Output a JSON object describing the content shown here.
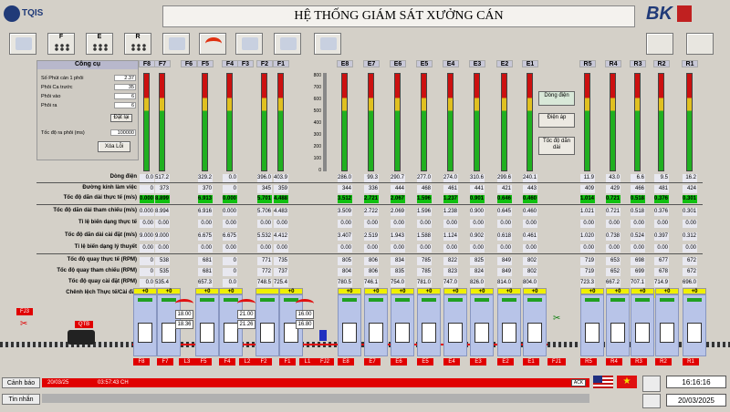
{
  "header": {
    "logo_text": "TQIS",
    "title": "HỆ THỐNG GIÁM SÁT XƯỞNG CÁN",
    "brand": "BK"
  },
  "toolbar": [
    {
      "label": "",
      "icon": "monitor-icon"
    },
    {
      "label": "F",
      "icon": "stand-f-icon"
    },
    {
      "label": "E",
      "icon": "stand-e-icon"
    },
    {
      "label": "R",
      "icon": "stand-r-icon"
    },
    {
      "label": "",
      "icon": "water-tap-icon"
    },
    {
      "label": "",
      "icon": "loop-arch-icon"
    },
    {
      "label": "",
      "icon": "up-down-arrows-icon"
    },
    {
      "label": "",
      "icon": "document-icon"
    },
    {
      "label": "",
      "icon": "edit-icon"
    }
  ],
  "tools_panel": {
    "title": "Công cụ",
    "rows": [
      {
        "label": "Số Phút cán 1 phôi",
        "value": "2.37"
      },
      {
        "label": "Phôi Ca trước",
        "value": "35"
      },
      {
        "label": "Phôi vào",
        "value": "6"
      },
      {
        "label": "Phôi ra",
        "value": "6"
      }
    ],
    "reset_label": "Đặt lại",
    "billet_speed_label": "Tốc độ ra phôi (ms)",
    "billet_speed_value": "100000",
    "clear_error_label": "Xóa Lỗi"
  },
  "stand_names": [
    "F8",
    "F7",
    "F6",
    "F5",
    "F4",
    "F3",
    "F2",
    "F1",
    "E8",
    "E7",
    "E6",
    "E5",
    "E4",
    "E3",
    "E2",
    "E1",
    "R5",
    "R4",
    "R3",
    "R2",
    "R1"
  ],
  "gauge_scale": [
    "800",
    "700",
    "600",
    "500",
    "400",
    "300",
    "200",
    "100",
    "0"
  ],
  "side_buttons": [
    "Dòng điện",
    "Điện áp",
    "Tốc độ dãn dài"
  ],
  "current_row": {
    "label": "Dòng điện",
    "values": [
      "0.0",
      "517.2",
      "",
      "329.2",
      "0.0",
      "",
      "396.0",
      "403.9",
      "286.0",
      "99.3",
      "290.7",
      "277.0",
      "274.0",
      "310.6",
      "299.6",
      "240.1",
      "11.9",
      "43.0",
      "6.6",
      "9.5",
      "16.2"
    ]
  },
  "table_rows": [
    {
      "label": "Đường kính làm việc",
      "values": [
        "0",
        "373",
        "",
        "370",
        "0",
        "",
        "345",
        "359",
        "344",
        "336",
        "444",
        "468",
        "461",
        "441",
        "421",
        "443",
        "409",
        "429",
        "466",
        "481",
        "424"
      ]
    },
    {
      "label": "Tốc độ dãn dài thực tế (m/s)",
      "green": true,
      "values": [
        "0.000",
        "8.899",
        "",
        "6.913",
        "0.000",
        "",
        "5.701",
        "4.488",
        "3.512",
        "2.721",
        "2.067",
        "1.596",
        "1.237",
        "0.901",
        "0.646",
        "0.460",
        "1.014",
        "0.721",
        "0.518",
        "0.376",
        "0.301"
      ]
    },
    {
      "label": "Tốc độ dãn dài tham chiếu (m/s)",
      "values": [
        "0.000",
        "8.994",
        "",
        "6.916",
        "0.000",
        "",
        "5.706",
        "4.483",
        "3.509",
        "2.722",
        "2.069",
        "1.596",
        "1.238",
        "0.900",
        "0.645",
        "0.460",
        "1.021",
        "0.721",
        "0.518",
        "0.376",
        "0.301"
      ]
    },
    {
      "label": "Tỉ lệ biến dạng thực tế",
      "values": [
        "0.00",
        "0.00",
        "",
        "0.00",
        "0.00",
        "",
        "0.00",
        "0.00",
        "0.00",
        "0.00",
        "0.00",
        "0.00",
        "0.00",
        "0.00",
        "0.00",
        "0.00",
        "0.00",
        "0.00",
        "0.00",
        "0.00",
        "0.00"
      ]
    },
    {
      "label": "Tốc độ dãn dài cài đặt (m/s)",
      "values": [
        "9.000",
        "9.000",
        "",
        "6.675",
        "6.675",
        "",
        "5.532",
        "4.412",
        "3.407",
        "2.519",
        "1.943",
        "1.588",
        "1.124",
        "0.902",
        "0.618",
        "0.461",
        "1.020",
        "0.738",
        "0.524",
        "0.397",
        "0.312"
      ]
    },
    {
      "label": "Tỉ lệ biến dạng lý thuyết",
      "values": [
        "0.00",
        "0.00",
        "",
        "0.00",
        "0.00",
        "",
        "0.00",
        "0.00",
        "0.00",
        "0.00",
        "0.00",
        "0.00",
        "0.00",
        "0.00",
        "0.00",
        "0.00",
        "0.00",
        "0.00",
        "0.00",
        "0.00",
        "0.00"
      ]
    },
    {
      "label": "Tốc độ quay thực tế (RPM)",
      "values": [
        "0",
        "538",
        "",
        "681",
        "0",
        "",
        "771",
        "735",
        "805",
        "806",
        "834",
        "785",
        "822",
        "825",
        "849",
        "802",
        "719",
        "653",
        "698",
        "677",
        "672"
      ]
    },
    {
      "label": "Tốc độ quay tham chiếu (RPM)",
      "values": [
        "0",
        "535",
        "",
        "681",
        "0",
        "",
        "772",
        "737",
        "804",
        "806",
        "835",
        "785",
        "823",
        "824",
        "849",
        "802",
        "719",
        "652",
        "699",
        "678",
        "672"
      ]
    },
    {
      "label": "Tốc độ quay cài đặt (RPM)",
      "values": [
        "0.0",
        "535.4",
        "",
        "657.3",
        "0.0",
        "",
        "748.5",
        "725.4",
        "780.5",
        "746.1",
        "754.0",
        "781.0",
        "747.0",
        "826.0",
        "814.0",
        "804.0",
        "723.3",
        "667.2",
        "707.1",
        "714.9",
        "696.0"
      ]
    },
    {
      "label": "Chênh lệch Thực tế/Cài đặt",
      "yellow": true,
      "values": [
        "+0",
        "+0",
        "",
        "+0",
        "+0",
        "",
        "+0",
        "+0",
        "+0",
        "+0",
        "+0",
        "+0",
        "+0",
        "+0",
        "+0",
        "+0",
        "+0",
        "+0",
        "+0",
        "+0",
        "+0"
      ]
    }
  ],
  "schematic": {
    "labels": [
      "FJ3",
      "QTB",
      "FJ2",
      "FJ1"
    ],
    "loops": [
      {
        "name": "L3",
        "set": "18.00",
        "actual": "18.36"
      },
      {
        "name": "L2",
        "set": "21.00",
        "actual": "21.26"
      },
      {
        "name": "L1",
        "set": "16.00",
        "actual": "16.80"
      }
    ],
    "bottom_labels": [
      "F8",
      "F7",
      "L3",
      "F5",
      "F4",
      "L2",
      "F2",
      "F1",
      "L1",
      "FJ2",
      "E8",
      "E7",
      "E6",
      "E5",
      "E4",
      "E3",
      "E2",
      "E1",
      "FJ1",
      "R5",
      "R4",
      "R3",
      "R2",
      "R1"
    ]
  },
  "status": {
    "alarm_tab": "Cảnh báo",
    "message_tab": "Tin nhắn",
    "alarm_date": "20/03/25",
    "alarm_time": "03:57:43 CH",
    "ack": "ACK",
    "time": "16:16:16",
    "date": "20/03/2025"
  },
  "colors": {
    "alarm": "#e00000",
    "bar_ok": "#20b020",
    "bar_warn": "#e0c020",
    "bar_alarm": "#cc1010"
  }
}
